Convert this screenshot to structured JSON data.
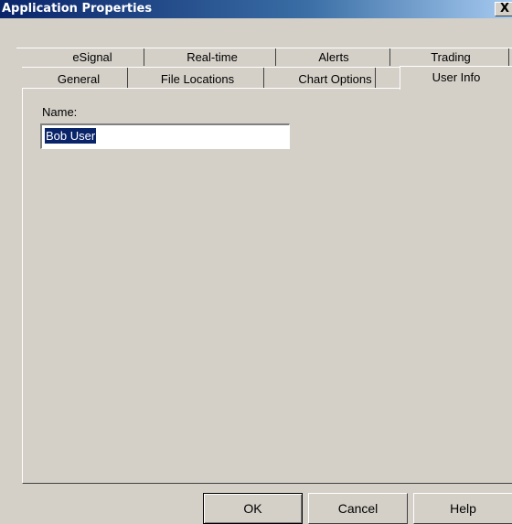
{
  "window": {
    "title": "Application Properties",
    "close_glyph": "X",
    "close_icon": "close-icon"
  },
  "tabs": {
    "row1": [
      "eSignal",
      "Real-time",
      "Alerts",
      "Trading"
    ],
    "row2": [
      "General",
      "File Locations",
      "Chart Options",
      "User Info"
    ],
    "active": "User Info"
  },
  "user_info": {
    "name_label": "Name:",
    "name_value": "Bob User"
  },
  "buttons": {
    "ok": "OK",
    "cancel": "Cancel",
    "help": "Help"
  },
  "colors": {
    "title_active": "#0a246a",
    "face": "#d4d0c8",
    "selection": "#0a246a"
  }
}
